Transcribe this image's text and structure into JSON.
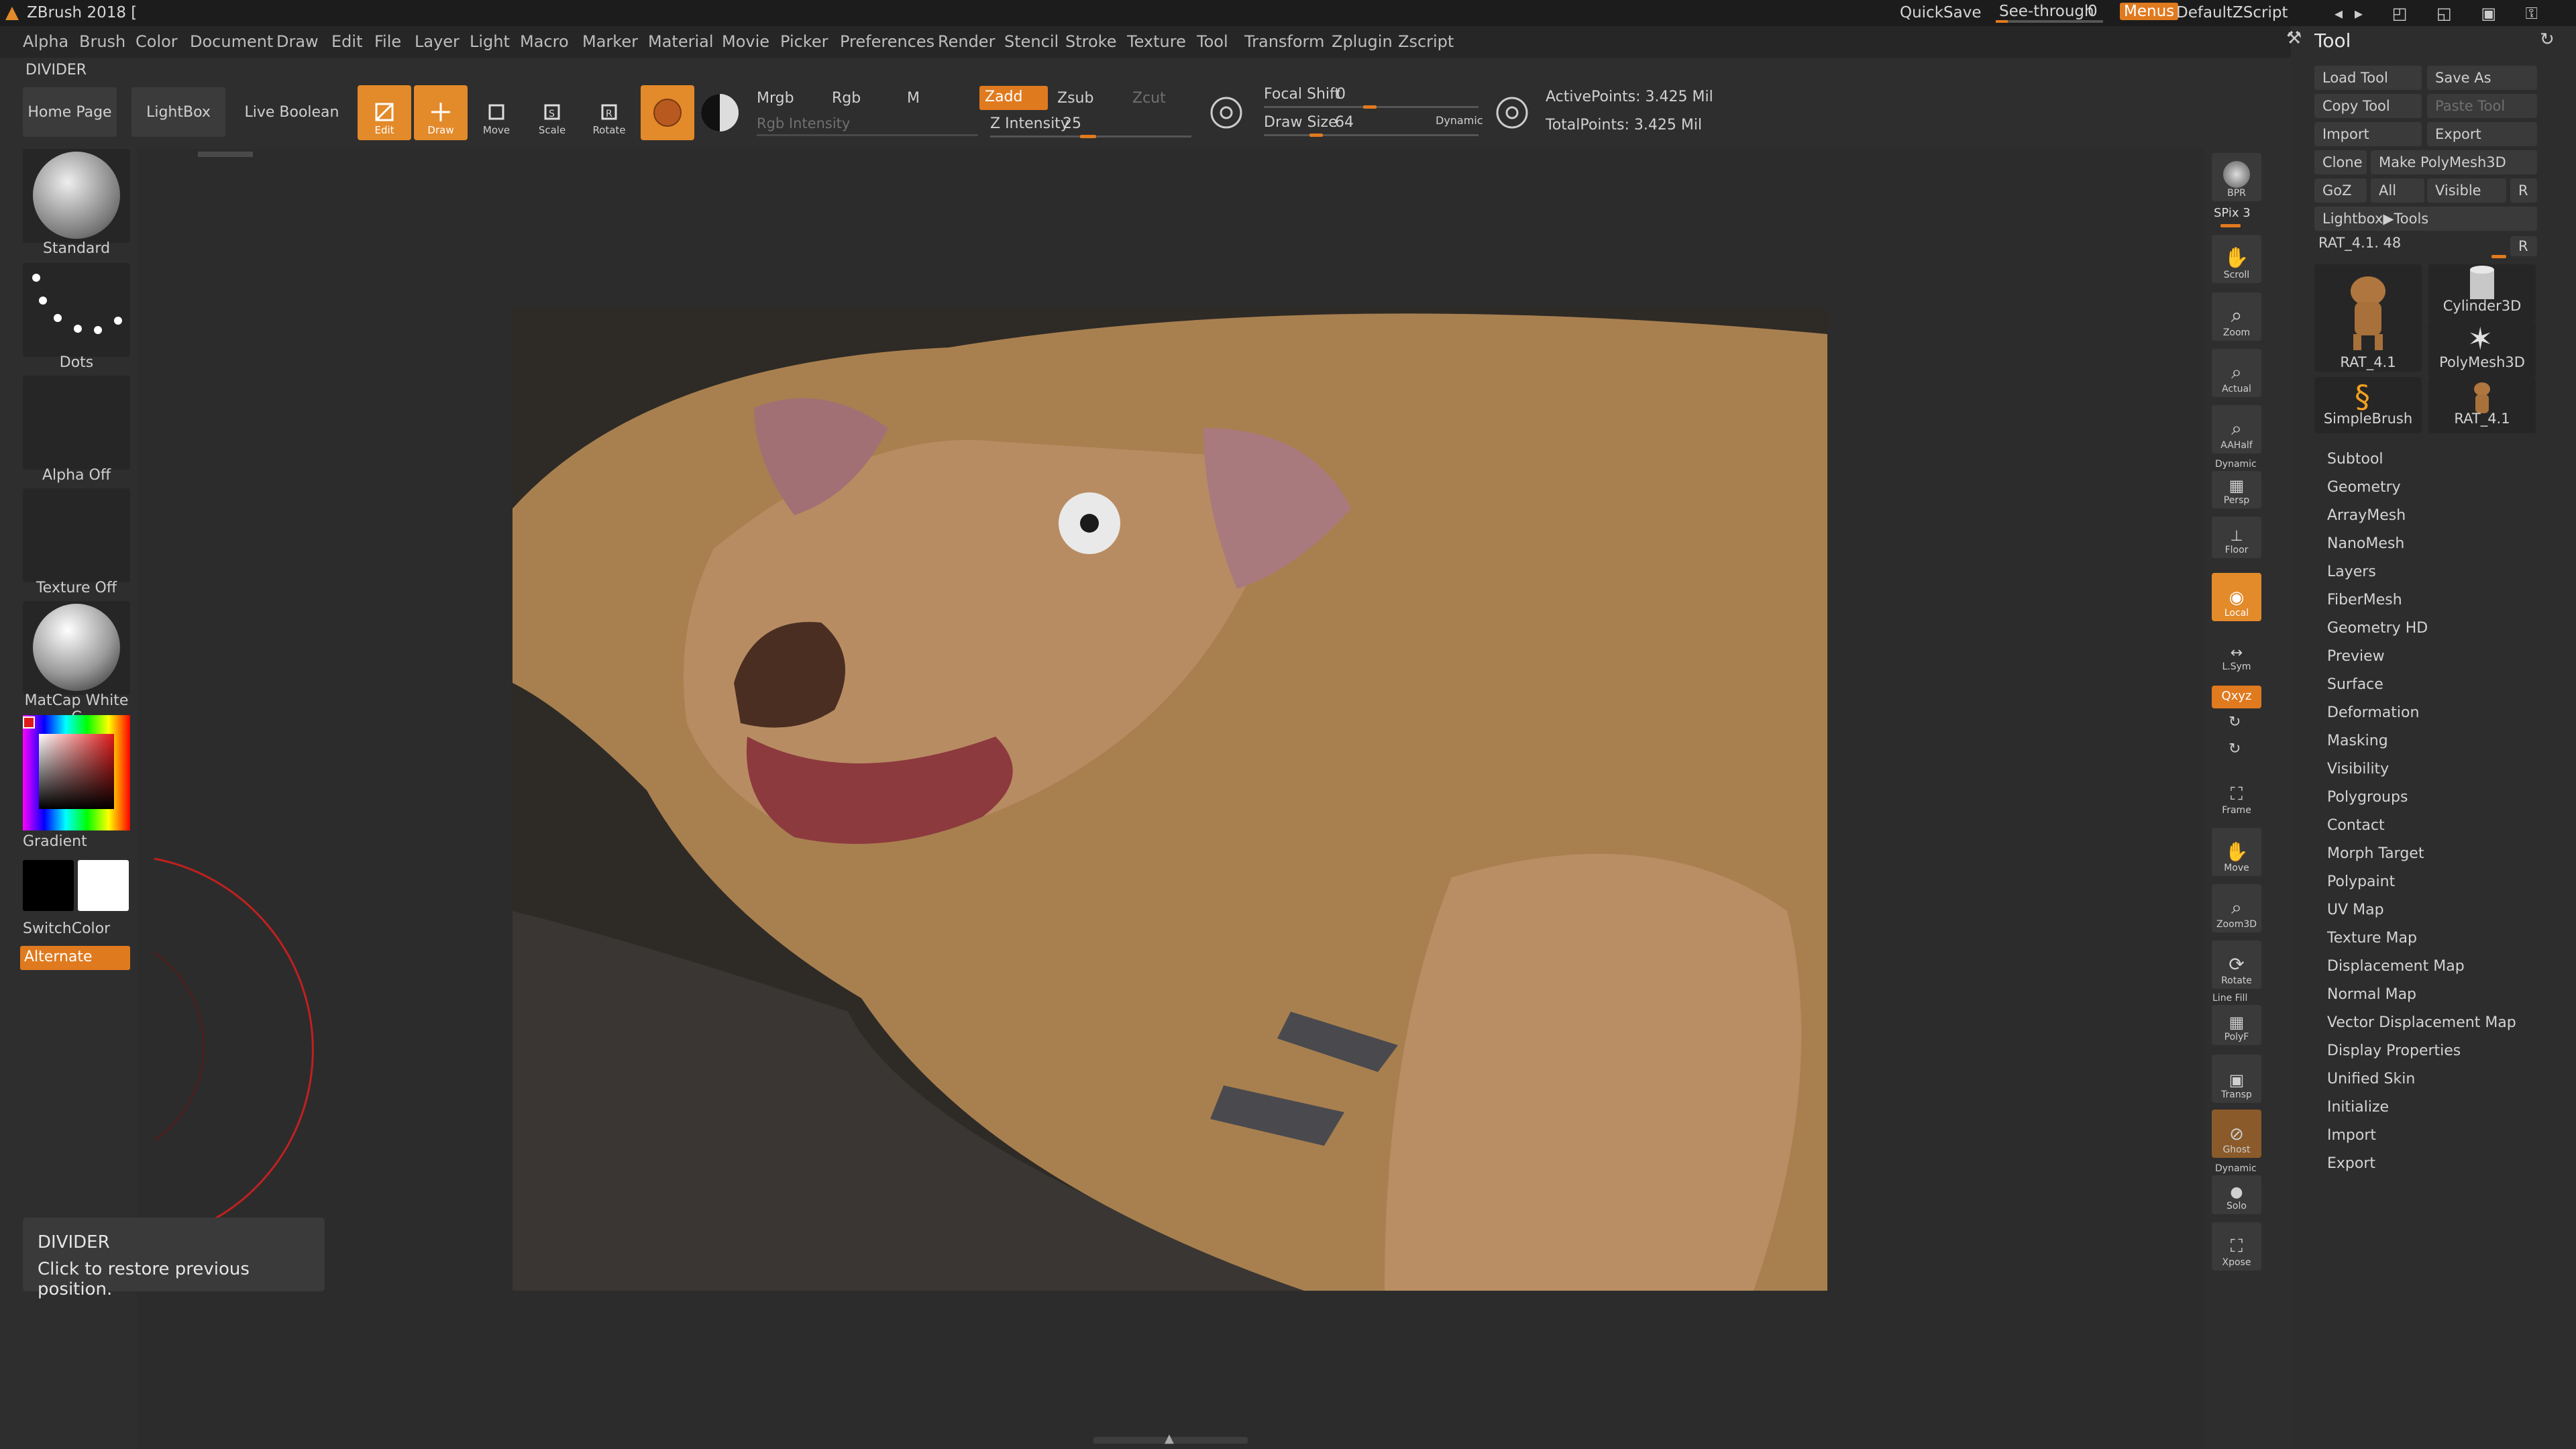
{
  "app": {
    "title": "ZBrush 2018 [",
    "quicksave": "QuickSave",
    "seethrough_label": "See-through",
    "seethrough_value": "0",
    "menus_button": "Menus",
    "default_script": "DefaultZScript"
  },
  "menubar": [
    "Alpha",
    "Brush",
    "Color",
    "Document",
    "Draw",
    "Edit",
    "File",
    "Layer",
    "Light",
    "Macro",
    "Marker",
    "Material",
    "Movie",
    "Picker",
    "Preferences",
    "Render",
    "Stencil",
    "Stroke",
    "Texture",
    "Tool",
    "Transform",
    "Zplugin",
    "Zscript"
  ],
  "divider_label": "DIVIDER",
  "toolbar": {
    "home_page": "Home Page",
    "lightbox": "LightBox",
    "live_boolean": "Live Boolean",
    "edit": "Edit",
    "draw": "Draw",
    "move": "Move",
    "scale": "Scale",
    "rotate": "Rotate",
    "mrgb": "Mrgb",
    "rgb": "Rgb",
    "m": "M",
    "rgb_intensity": "Rgb Intensity",
    "zadd": "Zadd",
    "zsub": "Zsub",
    "zcut": "Zcut",
    "z_intensity_label": "Z Intensity",
    "z_intensity_value": "25",
    "z_intensity_level": 0.25,
    "focal_shift_label": "Focal Shift",
    "focal_shift_value": "0",
    "draw_size_label": "Draw Size",
    "draw_size_value": "64",
    "dynamic": "Dynamic",
    "active_points": "ActivePoints: 3.425 Mil",
    "total_points": "TotalPoints: 3.425 Mil"
  },
  "leftshelf": {
    "brush": "Standard",
    "stroke": "Dots",
    "alpha": "Alpha Off",
    "texture": "Texture Off",
    "material": "MatCap White C",
    "gradient": "Gradient",
    "switchcolor": "SwitchColor",
    "alternate": "Alternate"
  },
  "tooltip": {
    "title": "DIVIDER",
    "text": "Click to restore previous position."
  },
  "rightshelf": {
    "bpr": "BPR",
    "spix_label": "SPix",
    "spix_value": "3",
    "scroll": "Scroll",
    "zoom": "Zoom",
    "actual": "Actual",
    "aahalf": "AAHalf",
    "dynamic": "Dynamic",
    "persp": "Persp",
    "floor": "Floor",
    "local": "Local",
    "lsym": "L.Sym",
    "xyz": "Qxyz",
    "frame": "Frame",
    "move": "Move",
    "zoom3d": "Zoom3D",
    "rotate": "Rotate",
    "linefill": "Line Fill",
    "polyf": "PolyF",
    "transp": "Transp",
    "ghost": "Ghost",
    "solo": "Solo",
    "xpose": "Xpose"
  },
  "toolpanel": {
    "title": "Tool",
    "load_tool": "Load Tool",
    "save_as": "Save As",
    "copy_tool": "Copy Tool",
    "paste_tool": "Paste Tool",
    "import": "Import",
    "export": "Export",
    "clone": "Clone",
    "make_polymesh": "Make PolyMesh3D",
    "goz": "GoZ",
    "all": "All",
    "visible": "Visible",
    "r": "R",
    "lightbox_tools": "Lightbox▶Tools",
    "current_tool": "RAT_4.1. 48",
    "thumbs": [
      "RAT_4.1",
      "Cylinder3D",
      "PolyMesh3D",
      "SimpleBrush",
      "RAT_4.1"
    ],
    "sections": [
      "Subtool",
      "Geometry",
      "ArrayMesh",
      "NanoMesh",
      "Layers",
      "FiberMesh",
      "Geometry HD",
      "Preview",
      "Surface",
      "Deformation",
      "Masking",
      "Visibility",
      "Polygroups",
      "Contact",
      "Morph Target",
      "Polypaint",
      "UV Map",
      "Texture Map",
      "Displacement Map",
      "Normal Map",
      "Vector Displacement Map",
      "Display Properties",
      "Unified Skin",
      "Initialize",
      "Import",
      "Export"
    ]
  },
  "colors": {
    "accent": "#e07a1f",
    "panel": "#2e2e2e",
    "canvas": "#2c2c2c"
  }
}
